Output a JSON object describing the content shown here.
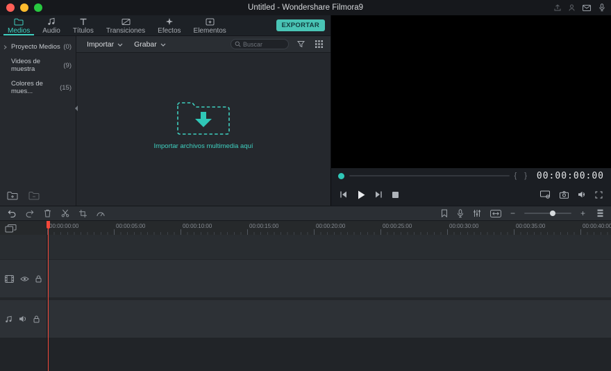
{
  "colors": {
    "accent": "#3fd0c0",
    "playhead": "#f4483a",
    "traffic_red": "#ff5f57",
    "traffic_yellow": "#febc2e",
    "traffic_green": "#28c840",
    "preview_bg": "#000000"
  },
  "titlebar": {
    "title": "Untitled - Wondershare Filmora9"
  },
  "tabbar": {
    "tabs": [
      {
        "label": "Medios",
        "active": true
      },
      {
        "label": "Audio",
        "active": false
      },
      {
        "label": "Títulos",
        "active": false
      },
      {
        "label": "Transiciones",
        "active": false
      },
      {
        "label": "Efectos",
        "active": false
      },
      {
        "label": "Elementos",
        "active": false
      }
    ],
    "export_label": "EXPORTAR"
  },
  "sidebar": {
    "items": [
      {
        "label": "Proyecto Medios",
        "count": "(0)"
      },
      {
        "label": "Videos de muestra",
        "count": "(9)"
      },
      {
        "label": "Colores de mues...",
        "count": "(15)"
      }
    ]
  },
  "media": {
    "toolbar": {
      "import_label": "Importar",
      "record_label": "Grabar",
      "search_placeholder": "Buscar"
    },
    "empty_label": "Importar archivos multimedia aquí"
  },
  "preview": {
    "timecode": "00:00:00:00",
    "brace_left": "{",
    "brace_right": "}"
  },
  "timeline": {
    "ruler_labels": [
      "00:00:00:00",
      "00:00:05:00",
      "00:00:10:00",
      "00:00:15:00",
      "00:00:20:00",
      "00:00:25:00",
      "00:00:30:00",
      "00:00:35:00",
      "00:00:40:00"
    ],
    "zoom_minus": "−",
    "zoom_plus": "+"
  },
  "icons": {
    "titlebar": [
      "share-icon",
      "account-icon",
      "mail-icon",
      "mic-icon"
    ],
    "tabbar": [
      "folder-icon",
      "music-note-icon",
      "titles-icon",
      "transition-icon",
      "effects-icon",
      "elements-icon"
    ],
    "sidebar": [
      "chevron-right-icon",
      "new-folder-icon",
      "delete-folder-icon"
    ],
    "media_toolbar": [
      "chevron-down-icon",
      "search-icon",
      "filter-icon",
      "grid-view-icon"
    ],
    "preview": [
      "previous-frame-icon",
      "play-icon",
      "next-frame-icon",
      "stop-icon",
      "display-settings-icon",
      "snapshot-icon",
      "volume-icon",
      "fullscreen-icon"
    ],
    "timeline_toolbar": [
      "undo-icon",
      "redo-icon",
      "delete-icon",
      "split-icon",
      "crop-icon",
      "speed-icon",
      "marker-icon",
      "record-voiceover-icon",
      "mixer-icon",
      "fit-timeline-icon",
      "zoom-out-icon",
      "zoom-slider",
      "zoom-in-icon",
      "track-options-icon"
    ],
    "track_headers": [
      "manage-tracks-icon",
      "video-track-icon",
      "eye-icon",
      "lock-icon",
      "audio-track-icon",
      "speaker-icon"
    ]
  }
}
